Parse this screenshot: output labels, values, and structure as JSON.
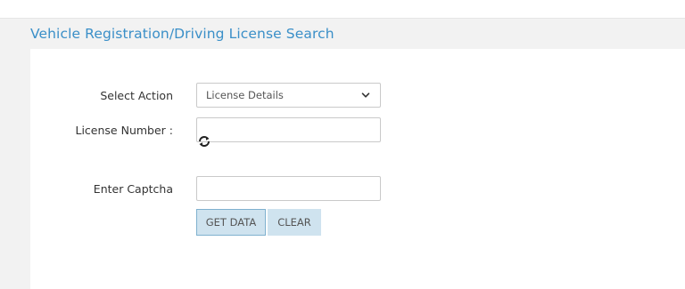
{
  "panel": {
    "title": "Vehicle Registration/Driving License Search"
  },
  "form": {
    "select_action_label": "Select Action",
    "select_action_value": "License Details",
    "license_number_label": "License Number :",
    "license_number_value": "",
    "captcha_label": "Enter Captcha",
    "captcha_value": ""
  },
  "buttons": {
    "get_data": "GET DATA",
    "clear": "CLEAR"
  },
  "icons": {
    "refresh": "refresh-captcha-icon",
    "dropdown": "chevron-down-icon"
  },
  "colors": {
    "title": "#3a8fc8",
    "button_bg": "#cfe3ef",
    "button_border": "#7fb1cf"
  }
}
